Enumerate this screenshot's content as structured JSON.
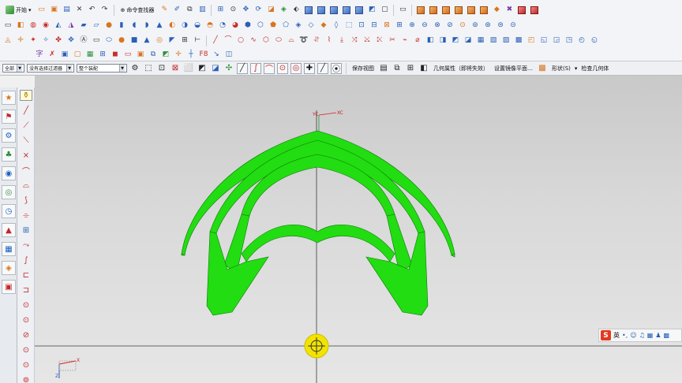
{
  "toolbar_row1": {
    "start_label": "开始",
    "command_finder_label": "命令查找器"
  },
  "selection_bar": {
    "filter_value": "全部",
    "select_filter_value": "没有选择过滤器",
    "assembly_scope_value": "整个装配",
    "saved_view_label": "保存视图",
    "geometry_property_label": "几何属性（即将失效）",
    "set_mirror_plane_label": "设置镜像平面…",
    "shape_label": "形状(S)",
    "check_geometry_label": "检查几何体"
  },
  "viewport": {
    "wcs_x_label": "XC",
    "wcs_y_label": "YC",
    "wcs_z_label": "ZC",
    "triad_x_label": "X",
    "triad_z_label": "Z",
    "model_color": "#22dd11",
    "model_edge_color": "#0b7a06"
  },
  "ime": {
    "lang_label": "英"
  }
}
